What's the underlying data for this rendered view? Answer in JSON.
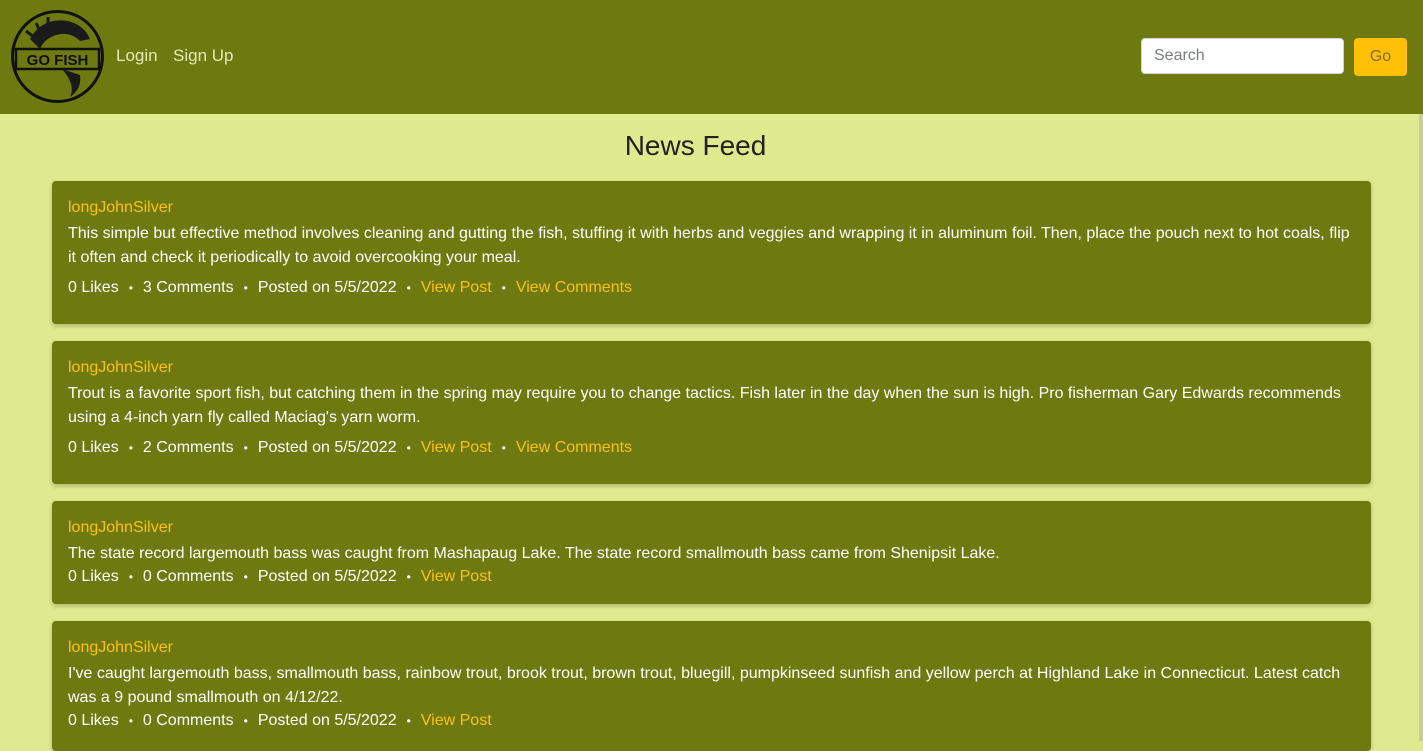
{
  "brand": {
    "logo_text": "GO FISH"
  },
  "nav": {
    "login": "Login",
    "signup": "Sign Up"
  },
  "search": {
    "placeholder": "Search",
    "button": "Go"
  },
  "page": {
    "title": "News Feed"
  },
  "common": {
    "view_post": "View Post",
    "view_comments": "View Comments",
    "separator": "•"
  },
  "posts": [
    {
      "author": "longJohnSilver",
      "body": "This simple but effective method involves cleaning and gutting the fish, stuffing it with herbs and veggies and wrapping it in aluminum foil. Then, place the pouch next to hot coals, flip it often and check it periodically to avoid overcooking your meal.",
      "likes": "0 Likes",
      "comments": "3 Comments",
      "posted": "Posted on 5/5/2022"
    },
    {
      "author": "longJohnSilver",
      "body": "Trout is a favorite sport fish, but catching them in the spring may require you to change tactics. Fish later in the day when the sun is high. Pro fisherman Gary Edwards recommends using a 4-inch yarn fly called Maciag's yarn worm.",
      "likes": "0 Likes",
      "comments": "2 Comments",
      "posted": "Posted on 5/5/2022"
    },
    {
      "author": "longJohnSilver",
      "body": "The state record largemouth bass was caught from Mashapaug Lake. The state record smallmouth bass came from Shenipsit Lake.",
      "likes": "0 Likes",
      "comments": "0 Comments",
      "posted": "Posted on 5/5/2022"
    },
    {
      "author": "longJohnSilver",
      "body": "I've caught largemouth bass, smallmouth bass, rainbow trout, brook trout, brown trout, bluegill, pumpkinseed sunfish and yellow perch at Highland Lake in Connecticut. Latest catch was a 9 pound smallmouth on 4/12/22.",
      "likes": "0 Likes",
      "comments": "0 Comments",
      "posted": "Posted on 5/5/2022"
    }
  ],
  "colors": {
    "navbar": "#6e7a10",
    "background": "#dfe98d",
    "accent": "#ffc107",
    "card": "#6e7a10"
  }
}
